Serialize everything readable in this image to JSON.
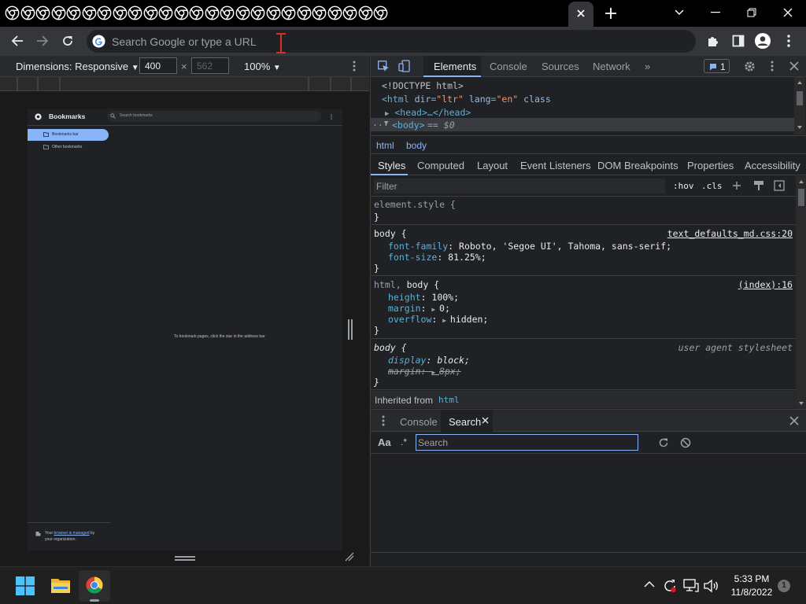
{
  "browser": {
    "tab_count": 25,
    "omnibox_placeholder": "Search Google or type a URL"
  },
  "device_toolbar": {
    "dimensions_label": "Dimensions: Responsive",
    "width_value": "400",
    "times": "×",
    "height_value": "562",
    "zoom_label": "100%"
  },
  "page": {
    "title": "Bookmarks",
    "search_placeholder": "Search bookmarks",
    "folders": [
      "Bookmarks bar",
      "Other bookmarks"
    ],
    "empty_message": "To bookmark pages, click the star in the address bar",
    "managed_prefix": "Your",
    "managed_link": "browser is managed",
    "managed_suffix": "by your organization."
  },
  "devtools": {
    "tabs": [
      "Elements",
      "Console",
      "Sources",
      "Network"
    ],
    "more_tabs": "»",
    "issues_count": "1",
    "dom": {
      "doctype": "<!DOCTYPE html>",
      "html_open_tag": "<html",
      "html_attr1_name": "dir",
      "html_attr1_val": "\"ltr\"",
      "html_attr2_name": "lang",
      "html_attr2_val": "\"en\"",
      "html_attr3_name": "class",
      "html_close": ">",
      "head": "<head>…</head>",
      "body_tag": "<body>",
      "body_selected": "== $0"
    },
    "breadcrumbs": [
      "html",
      "body"
    ],
    "style_tabs": [
      "Styles",
      "Computed",
      "Layout",
      "Event Listeners",
      "DOM Breakpoints",
      "Properties",
      "Accessibility"
    ],
    "filter_placeholder": "Filter",
    "hov": ":hov",
    "cls": ".cls",
    "rules": [
      {
        "selector": "element.style {",
        "close": "}",
        "source": ""
      },
      {
        "selector": "body {",
        "close": "}",
        "source": "text_defaults_md.css:20",
        "props": [
          {
            "name": "font-family",
            "value": "Roboto, 'Segoe UI', Tahoma, sans-serif;"
          },
          {
            "name": "font-size",
            "value": "81.25%;"
          }
        ]
      },
      {
        "selector_dim": "html,",
        "selector": "body {",
        "close": "}",
        "source": "(index):16",
        "props": [
          {
            "name": "height",
            "value": "100%;"
          },
          {
            "name": "margin",
            "value": "0;"
          },
          {
            "name": "overflow",
            "value": "hidden;"
          }
        ]
      },
      {
        "selector": "body {",
        "close": "}",
        "source": "user agent stylesheet",
        "props": [
          {
            "name": "display",
            "value": "block;"
          },
          {
            "name": "margin",
            "value": "8px;"
          }
        ]
      }
    ],
    "inherited_label": "Inherited from",
    "inherited_tag": "html",
    "drawer_tabs": [
      "Console",
      "Search"
    ],
    "search_placeholder": "Search",
    "aa": "Aa",
    "regex": ".*"
  },
  "taskbar": {
    "time": "5:33 PM",
    "date": "11/8/2022",
    "notification_count": "1"
  },
  "colors": {
    "accent": "#8ab4f8",
    "folder_selected_bg": "#8ab4f8",
    "tag_color": "#5db0d7",
    "source_underline": "#e8eaed"
  }
}
